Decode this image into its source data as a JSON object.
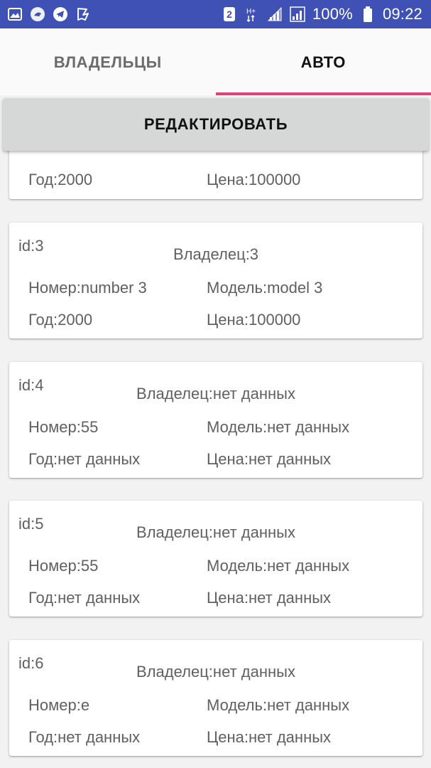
{
  "status_bar": {
    "battery_percent": "100%",
    "time": "09:22",
    "sim_badge": "2",
    "network_type": "H+",
    "left_icons": [
      "gallery-icon",
      "app-icon",
      "telegram-icon",
      "vk-icon"
    ],
    "background": "#3f51b5"
  },
  "tabs": [
    {
      "label": "ВЛАДЕЛЬЦЫ",
      "selected": false
    },
    {
      "label": "АВТО",
      "selected": true
    }
  ],
  "accent_color": "#e0407b",
  "edit_button": {
    "label": "РЕДАКТИРОВАТЬ"
  },
  "cars": [
    {
      "id": "",
      "owner": "",
      "number": "",
      "model": "",
      "year": "Год:2000",
      "price": "Цена:100000"
    },
    {
      "id": "id:3",
      "owner": "Владелец:3",
      "number": "Номер:number 3",
      "model": "Модель:model 3",
      "year": "Год:2000",
      "price": "Цена:100000"
    },
    {
      "id": "id:4",
      "owner": "Владелец:нет данных",
      "number": "Номер:55",
      "model": "Модель:нет данных",
      "year": "Год:нет данных",
      "price": "Цена:нет данных"
    },
    {
      "id": "id:5",
      "owner": "Владелец:нет данных",
      "number": "Номер:55",
      "model": "Модель:нет данных",
      "year": "Год:нет данных",
      "price": "Цена:нет данных"
    },
    {
      "id": "id:6",
      "owner": "Владелец:нет данных",
      "number": "Номер:e",
      "model": "Модель:нет данных",
      "year": "Год:нет данных",
      "price": "Цена:нет данных"
    }
  ]
}
